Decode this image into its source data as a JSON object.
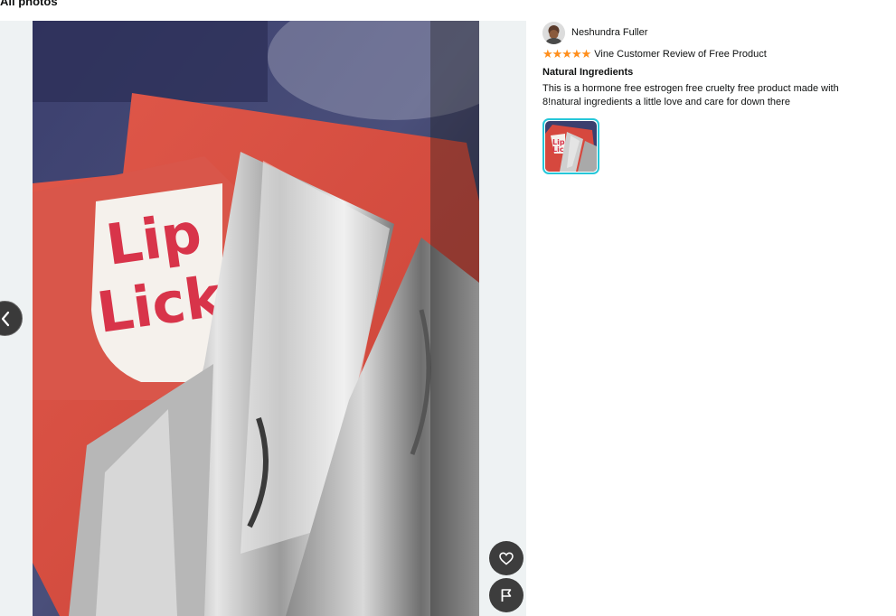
{
  "page": {
    "heading": "All photos"
  },
  "viewer": {
    "photo_text": [
      "Lip",
      "Lick"
    ],
    "prev_icon": "chevron-left-icon",
    "like_icon": "heart-icon",
    "flag_icon": "flag-icon"
  },
  "review": {
    "author": "Neshundra Fuller",
    "rating": 5,
    "rating_max": 5,
    "stars": "★★★★★",
    "vine_label": "Vine Customer Review of Free Product",
    "title": "Natural Ingredients",
    "body": "This is a hormone free estrogen free cruelty free product made with 8!natural ingredients a little love and care for down there"
  },
  "colors": {
    "star": "#ff8f1c",
    "thumb_border": "#26c7d9",
    "button_bg": "#3d3d3d",
    "viewer_bg": "#eef2f3"
  }
}
